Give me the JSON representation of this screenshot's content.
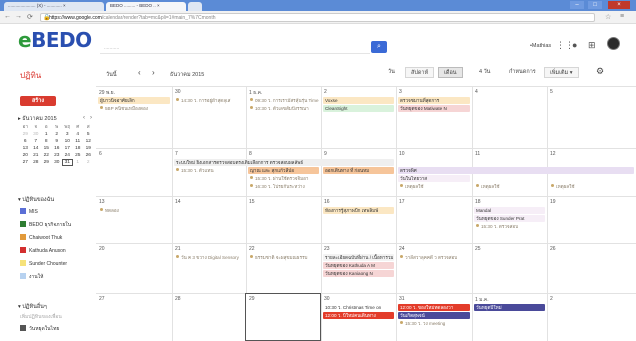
{
  "browser": {
    "tabs": [
      {
        "label": "...................... (X) - ............ ×"
      },
      {
        "label": "BEDO ......... - BEDO .. ×"
      }
    ],
    "url_host": "https://www.google.com",
    "url_path": "/calendar/render?tab=mc&pli=1#main_7%7Cmonth"
  },
  "header": {
    "logo_text": "BEDO",
    "search_placeholder": "...........",
    "user_name": "•Mathias"
  },
  "sidebar": {
    "page_title": "ปฏิทิน",
    "create_label": "สร้าง",
    "mini_calendar": {
      "title": "▸ ธันวาคม 2015",
      "weekdays": [
        "อา",
        "จ",
        "อ",
        "พ",
        "พฤ",
        "ศ",
        "ส"
      ],
      "weeks": [
        [
          {
            "d": "29",
            "dim": true
          },
          {
            "d": "30",
            "dim": true
          },
          {
            "d": "1"
          },
          {
            "d": "2"
          },
          {
            "d": "3"
          },
          {
            "d": "4"
          },
          {
            "d": "5"
          }
        ],
        [
          {
            "d": "6"
          },
          {
            "d": "7"
          },
          {
            "d": "8"
          },
          {
            "d": "9"
          },
          {
            "d": "10"
          },
          {
            "d": "11"
          },
          {
            "d": "12"
          }
        ],
        [
          {
            "d": "13"
          },
          {
            "d": "14"
          },
          {
            "d": "15"
          },
          {
            "d": "16"
          },
          {
            "d": "17"
          },
          {
            "d": "18"
          },
          {
            "d": "19"
          }
        ],
        [
          {
            "d": "20"
          },
          {
            "d": "21"
          },
          {
            "d": "22"
          },
          {
            "d": "23"
          },
          {
            "d": "24"
          },
          {
            "d": "25"
          },
          {
            "d": "26"
          }
        ],
        [
          {
            "d": "27"
          },
          {
            "d": "28"
          },
          {
            "d": "29"
          },
          {
            "d": "30"
          },
          {
            "d": "31",
            "today": true
          },
          {
            "d": "1",
            "dim": true
          },
          {
            "d": "2",
            "dim": true
          }
        ]
      ]
    },
    "my_calendars_label": "▾ ปฏิทินของฉัน",
    "calendars": [
      {
        "label": "MIS",
        "color": "#5b6fd6"
      },
      {
        "label": "BEDO ธุรกิจภายใน",
        "color": "#2e7d32"
      },
      {
        "label": "Chaiwoot Thuk",
        "color": "#e29a3a"
      },
      {
        "label": "Kathuda Anuson",
        "color": "#d32f2f"
      },
      {
        "label": "Sunder Chounter",
        "color": "#f6e27a"
      },
      {
        "label": "งานให้",
        "color": "#b7d2f0"
      }
    ],
    "other_calendars_label": "▾ ปฏิทินอื่นๆ",
    "other_placeholder": "เพิ่มปฏิทินของเพื่อน",
    "other_items": [
      {
        "label": "วันหยุดในไทย",
        "color": "#555555"
      }
    ]
  },
  "toolbar": {
    "today_label": "วันนี้",
    "prev": "‹",
    "next": "›",
    "month_title": "ธันวาคม 2015",
    "views": [
      "วัน",
      "สัปดาห์",
      "เดือน",
      "4 วัน",
      "กำหนดการ"
    ],
    "active_view": "เดือน",
    "more_label": "เพิ่มเติม ▾",
    "settings_icon": "gear-icon"
  },
  "grid": {
    "days": [
      [
        "29 พ.ย.",
        "30",
        "1 ธ.ค.",
        "2",
        "3",
        "4",
        "5"
      ],
      [
        "6",
        "7",
        "8",
        "9",
        "10",
        "11",
        "12"
      ],
      [
        "13",
        "14",
        "15",
        "16",
        "17",
        "18",
        "19"
      ],
      [
        "20",
        "21",
        "22",
        "23",
        "24",
        "25",
        "26"
      ],
      [
        "27",
        "28",
        "29",
        "30",
        "31",
        "1 ม.ค.",
        "2"
      ]
    ],
    "events": [
      {
        "text": "ผู้บาวนิจอาศัยเลิก",
        "row": 0,
        "col": 0,
        "line": 0,
        "style": "bg",
        "color": "#fbe7c3"
      },
      {
        "text": "5BP คนิชนเหมืองดอง",
        "row": 0,
        "col": 0,
        "line": 1,
        "style": "plain"
      },
      {
        "text": "14:30 ว. การอยู่ผ้าสุดลุเส",
        "row": 0,
        "col": 1,
        "line": 0,
        "style": "plain"
      },
      {
        "text": "09:30 ว. การเรามัสรลุ้นรุ่น Time",
        "row": 0,
        "col": 2,
        "line": 0,
        "style": "plain"
      },
      {
        "text": "10:30 ว. ตัวเลขสัมปังรรณา",
        "row": 0,
        "col": 2,
        "line": 1,
        "style": "plain"
      },
      {
        "text": "Voxse",
        "row": 0,
        "col": 3,
        "line": 0,
        "style": "bg",
        "color": "#fbe7c3"
      },
      {
        "text": "CleanSight",
        "row": 0,
        "col": 3,
        "line": 1,
        "style": "bg",
        "color": "#d9f2dc"
      },
      {
        "text": "ตรวจชมานที่สุดการ",
        "row": 0,
        "col": 4,
        "line": 0,
        "style": "bg",
        "color": "#fbe7c3"
      },
      {
        "text": "วันหยุดของ Matiwate N",
        "row": 0,
        "col": 4,
        "line": 1,
        "style": "bg",
        "color": "#f6d5d5"
      },
      {
        "text": "ระบบใหม่ ยิงเอกสารตรวจสอบตรงเติมเลือกการ ตรวจสอบผลลัพธ์",
        "row": 1,
        "col": 1,
        "line": 0,
        "style": "bg",
        "color": "#efefef",
        "span": 3
      },
      {
        "text": "15:30 ว. ตัวแทน",
        "row": 1,
        "col": 1,
        "line": 1,
        "style": "plain"
      },
      {
        "text": "ญาณ และ สุกแก้วลีป่อ",
        "row": 1,
        "col": 2,
        "line": 1,
        "style": "bg",
        "color": "#f6c59a"
      },
      {
        "text": "15:30 ว. ผ่านใช้ตรวจจิมอา",
        "row": 1,
        "col": 2,
        "line": 2,
        "style": "plain"
      },
      {
        "text": "16:30 ว. โปรยกันระหว่าง",
        "row": 1,
        "col": 2,
        "line": 3,
        "style": "plain"
      },
      {
        "text": "ออกเดินทาง ที่ ก่อนหม",
        "row": 1,
        "col": 3,
        "line": 1,
        "style": "bg",
        "color": "#f6c59a"
      },
      {
        "text": "ตรวจพิศ",
        "row": 1,
        "col": 4,
        "line": 1,
        "style": "bg",
        "color": "#e8def2",
        "span": 3
      },
      {
        "text": "วันในไทยวาส",
        "row": 1,
        "col": 4,
        "line": 2,
        "style": "bg",
        "color": "#f6eef7"
      },
      {
        "text": "เหตุผลใช้",
        "row": 1,
        "col": 4,
        "line": 3,
        "style": "plain"
      },
      {
        "text": "เหตุผลใช้",
        "row": 1,
        "col": 5,
        "line": 3,
        "style": "plain"
      },
      {
        "text": "เหตุผลใช้",
        "row": 1,
        "col": 6,
        "line": 3,
        "style": "plain"
      },
      {
        "text": "ทดลอง",
        "row": 2,
        "col": 0,
        "line": 0,
        "style": "plain"
      },
      {
        "text": "ห้องการรู้สุภาพปีก เทพลิมพ์",
        "row": 2,
        "col": 3,
        "line": 0,
        "style": "bg",
        "color": "#fbe7c3"
      },
      {
        "text": "Mandal",
        "row": 2,
        "col": 5,
        "line": 0,
        "style": "bg",
        "color": "#f6eef7"
      },
      {
        "text": "วันหยุดของ Sunder Prat",
        "row": 2,
        "col": 5,
        "line": 1,
        "style": "bg",
        "color": "#f6eef7"
      },
      {
        "text": "15:30 ว. ตรวจสอบ",
        "row": 2,
        "col": 5,
        "line": 2,
        "style": "plain"
      },
      {
        "text": "วัน ค 3 ขวาง Digital Sensory",
        "row": 3,
        "col": 1,
        "line": 0,
        "style": "plain"
      },
      {
        "text": "ธรรมชาติ จะผสุขมณธรรบ",
        "row": 3,
        "col": 2,
        "line": 0,
        "style": "plain"
      },
      {
        "text": "รายละเอียดฉบับที่ผ่าน / เนื้อหารวม",
        "row": 3,
        "col": 3,
        "line": 0,
        "style": "bg",
        "color": "#f3f3f3"
      },
      {
        "text": "วันหยุดของ Kathuda A M",
        "row": 3,
        "col": 3,
        "line": 1,
        "style": "bg",
        "color": "#f6d5d5"
      },
      {
        "text": "วันหยุดของ Kaniaong N",
        "row": 3,
        "col": 3,
        "line": 2,
        "style": "bg",
        "color": "#f6d5d5"
      },
      {
        "text": "วาลีสวาลุคคดี ว ตรวจสอบ",
        "row": 3,
        "col": 4,
        "line": 0,
        "style": "plain"
      },
      {
        "text": "10:30 ว. Christmas Time on",
        "row": 4,
        "col": 3,
        "line": 0,
        "style": "bg",
        "color": "#fff"
      },
      {
        "text": "12:00 ว. ปีใหม่คนเดินทาง",
        "row": 4,
        "col": 3,
        "line": 1,
        "style": "bg",
        "color": "#e33c2a",
        "textColor": "#fff"
      },
      {
        "text": "12:00 ว. ของใหม่ทดลองวา",
        "row": 4,
        "col": 4,
        "line": 0,
        "style": "bg",
        "color": "#e33c2a",
        "textColor": "#fff"
      },
      {
        "text": "วันเกิดสุพจน์",
        "row": 4,
        "col": 4,
        "line": 1,
        "style": "bg",
        "color": "#4a4a9a",
        "textColor": "#fff"
      },
      {
        "text": "15:30 ว. วง meeting",
        "row": 4,
        "col": 4,
        "line": 2,
        "style": "plain"
      },
      {
        "text": "วันหยุดปีใหม่",
        "row": 4,
        "col": 5,
        "line": 0,
        "style": "bg",
        "color": "#4a4a9a",
        "textColor": "#fff"
      }
    ]
  }
}
